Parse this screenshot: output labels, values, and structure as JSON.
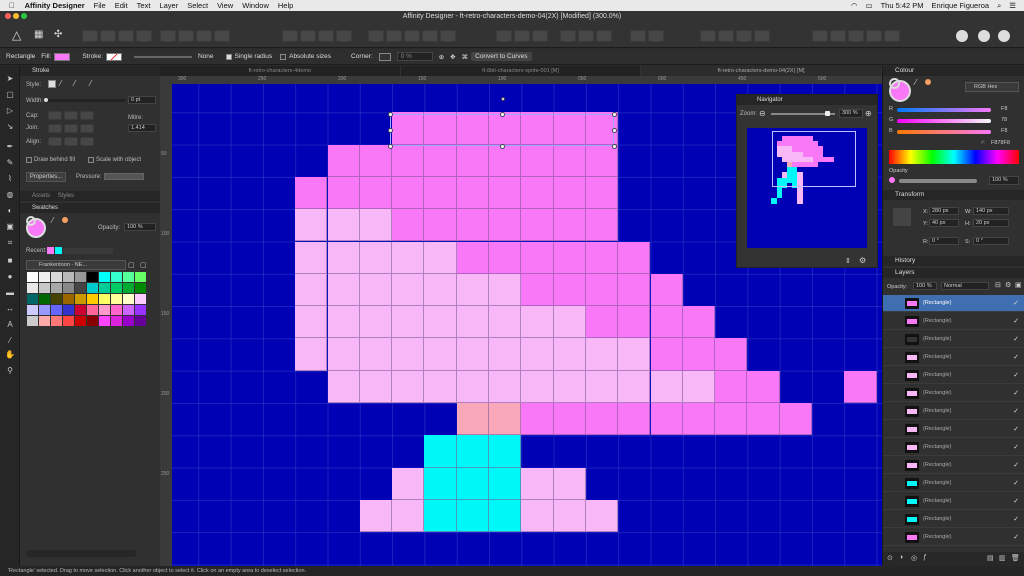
{
  "menubar": {
    "apple": "",
    "app": "Affinity Designer",
    "items": [
      "File",
      "Edit",
      "Text",
      "Layer",
      "Select",
      "View",
      "Window",
      "Help"
    ],
    "clock": "Thu 5:42 PM",
    "user": "Enrique Figueroa"
  },
  "window": {
    "title": "Affinity Designer - ft-retro-characters-demo-04(2X) [Modified] (300.0%)"
  },
  "context": {
    "object": "Rectangle",
    "fill_label": "Fill:",
    "fill_color": "#f878f8",
    "stroke_label": "Stroke:",
    "stroke_width": "None",
    "single_radius": "Single radius",
    "absolute_sizes": "Absolute sizes",
    "corner_label": "Corner:",
    "corner_value": "0 %",
    "convert": "Convert to Curves"
  },
  "tabs": [
    "ft-retro-characters-4demo",
    "ft-8bit-characters-sprite-001 [M]",
    "ft-retro-characters-demo-04(2X) [M]"
  ],
  "ruler_top": [
    "300",
    "250",
    "200",
    "150",
    "100",
    "050",
    "000",
    "450",
    "500",
    "550"
  ],
  "ruler_left": [
    "50",
    "100",
    "150",
    "200",
    "250"
  ],
  "stroke": {
    "title": "Stroke",
    "style": "Style:",
    "width_label": "Width:",
    "width_value": "0 pt",
    "cap": "Cap:",
    "join": "Join:",
    "align": "Align:",
    "mitre_label": "Mitre:",
    "mitre_value": "1.414",
    "draw_behind": "Draw behind fill",
    "scale": "Scale with object",
    "properties": "Properties...",
    "pressure": "Pressure:"
  },
  "assets_tab": "Assets",
  "styles_tab": "Styles",
  "swatches": {
    "title": "Swatches",
    "opacity_label": "Opacity:",
    "opacity_value": "100 %",
    "recent_label": "Recent:",
    "palette_name": "Frankentoon - NE...",
    "recent": [
      "#f878f8",
      "#00f8f8"
    ],
    "grid": [
      "#ffffff",
      "#f0f0f0",
      "#d8d8d8",
      "#b8b8b8",
      "#989898",
      "#000000",
      "#00ffff",
      "#33ffcc",
      "#55ff99",
      "#66ff66",
      "#e8e8e8",
      "#c8c8c8",
      "#a8a8a8",
      "#888888",
      "#444444",
      "#00cccc",
      "#00cc99",
      "#00cc66",
      "#00aa33",
      "#008800",
      "#006666",
      "#006600",
      "#444400",
      "#996600",
      "#cc9900",
      "#ffcc00",
      "#ffff66",
      "#ffff99",
      "#ffffcc",
      "#ffccff",
      "#ccccff",
      "#9999ff",
      "#6666ff",
      "#3333cc",
      "#cc0033",
      "#ff6699",
      "#ff99cc",
      "#ff66cc",
      "#cc66ff",
      "#9933ff",
      "#cccccc",
      "#ffaaaa",
      "#ff7777",
      "#ff4444",
      "#cc0000",
      "#880000",
      "#ff44ff",
      "#dd22dd",
      "#9900cc",
      "#660099"
    ]
  },
  "navigator": {
    "title": "Navigator",
    "zoom_label": "Zoom:",
    "zoom_value": "300 %"
  },
  "colour": {
    "title": "Colour",
    "mode": "RGB Hex",
    "r_label": "R",
    "r_value": "F8",
    "g_label": "G",
    "g_value": "78",
    "b_label": "B",
    "b_value": "F8",
    "hex": "F878F8",
    "opacity_label": "Opacity",
    "opacity_value": "100 %"
  },
  "transform": {
    "title": "Transform",
    "x_label": "X:",
    "x_value": "280 px",
    "y_label": "Y:",
    "y_value": "40 px",
    "w_label": "W:",
    "w_value": "140 px",
    "h_label": "H:",
    "h_value": "20 px",
    "r_label": "R:",
    "r_value": "0 °",
    "s_label": "S:",
    "s_value": "0 °"
  },
  "history": {
    "title": "History"
  },
  "layers": {
    "title": "Layers",
    "opacity_label": "Opacity:",
    "opacity_value": "100 %",
    "blend": "Normal",
    "items": [
      "(Rectangle)",
      "(Rectangle)",
      "(Rectangle)",
      "(Rectangle)",
      "(Rectangle)",
      "(Rectangle)",
      "(Rectangle)",
      "(Rectangle)",
      "(Rectangle)",
      "(Rectangle)",
      "(Rectangle)",
      "(Rectangle)",
      "(Rectangle)",
      "(Rectangle)"
    ],
    "thumb_colors": [
      "#f878f8",
      "#f878f8",
      "#333333",
      "#f8b8f8",
      "#f8b8f8",
      "#f8b8f8",
      "#f8b8f8",
      "#f8b8f8",
      "#f8b8f8",
      "#f8b8f8",
      "#00f8f8",
      "#00f8f8",
      "#00f8f8",
      "#f878f8"
    ]
  },
  "status": {
    "text": "'Rectangle' selected. Drag to move selection. Click another object to select it. Click on an empty area to deselect selection."
  },
  "colors": {
    "canvas_bg": "#0000b4",
    "pink": "#f878f8",
    "light_pink": "#f8b8f8",
    "cyan": "#00f8f8",
    "salmon": "#f8a8b8",
    "selection": "#3f6fb0"
  }
}
